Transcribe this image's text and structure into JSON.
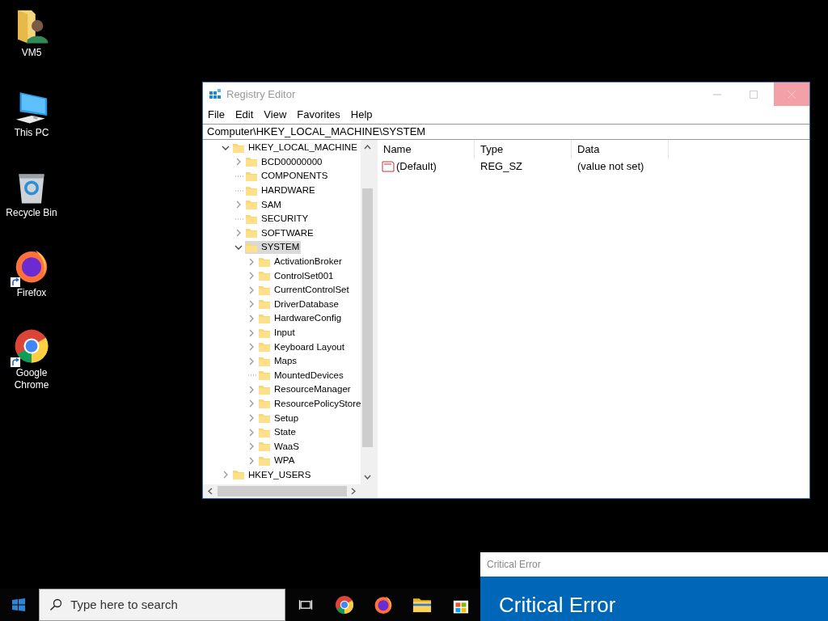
{
  "desktop_icons": [
    {
      "label": "VM5",
      "kind": "user-folder",
      "shortcut": false
    },
    {
      "label": "This PC",
      "kind": "computer",
      "shortcut": false
    },
    {
      "label": "Recycle Bin",
      "kind": "recycle-bin",
      "shortcut": false
    },
    {
      "label": "Firefox",
      "kind": "firefox",
      "shortcut": true
    },
    {
      "label": "Google Chrome",
      "kind": "chrome",
      "shortcut": true
    }
  ],
  "registry_editor": {
    "title": "Registry Editor",
    "menu": [
      "File",
      "Edit",
      "View",
      "Favorites",
      "Help"
    ],
    "address": "Computer\\HKEY_LOCAL_MACHINE\\SYSTEM",
    "tree": [
      {
        "label": "HKEY_LOCAL_MACHINE",
        "kind": "branch",
        "expanded": true,
        "selected": false,
        "children": [
          {
            "label": "BCD00000000",
            "kind": "branch",
            "expanded": false,
            "selected": false
          },
          {
            "label": "COMPONENTS",
            "kind": "leaf",
            "selected": false
          },
          {
            "label": "HARDWARE",
            "kind": "leaf",
            "selected": false
          },
          {
            "label": "SAM",
            "kind": "branch",
            "expanded": false,
            "selected": false
          },
          {
            "label": "SECURITY",
            "kind": "leaf",
            "selected": false
          },
          {
            "label": "SOFTWARE",
            "kind": "branch",
            "expanded": false,
            "selected": false
          },
          {
            "label": "SYSTEM",
            "kind": "branch",
            "expanded": true,
            "selected": true,
            "children": [
              {
                "label": "ActivationBroker",
                "kind": "branch",
                "expanded": false,
                "selected": false
              },
              {
                "label": "ControlSet001",
                "kind": "branch",
                "expanded": false,
                "selected": false
              },
              {
                "label": "CurrentControlSet",
                "kind": "branch",
                "expanded": false,
                "selected": false
              },
              {
                "label": "DriverDatabase",
                "kind": "branch",
                "expanded": false,
                "selected": false
              },
              {
                "label": "HardwareConfig",
                "kind": "branch",
                "expanded": false,
                "selected": false
              },
              {
                "label": "Input",
                "kind": "branch",
                "expanded": false,
                "selected": false
              },
              {
                "label": "Keyboard Layout",
                "kind": "branch",
                "expanded": false,
                "selected": false
              },
              {
                "label": "Maps",
                "kind": "branch",
                "expanded": false,
                "selected": false
              },
              {
                "label": "MountedDevices",
                "kind": "leaf",
                "selected": false
              },
              {
                "label": "ResourceManager",
                "kind": "branch",
                "expanded": false,
                "selected": false
              },
              {
                "label": "ResourcePolicyStore",
                "kind": "branch",
                "expanded": false,
                "selected": false
              },
              {
                "label": "Setup",
                "kind": "branch",
                "expanded": false,
                "selected": false
              },
              {
                "label": "State",
                "kind": "branch",
                "expanded": false,
                "selected": false
              },
              {
                "label": "WaaS",
                "kind": "branch",
                "expanded": false,
                "selected": false
              },
              {
                "label": "WPA",
                "kind": "branch",
                "expanded": false,
                "selected": false
              }
            ]
          }
        ]
      },
      {
        "label": "HKEY_USERS",
        "kind": "branch",
        "expanded": false,
        "selected": false
      }
    ],
    "columns": [
      "Name",
      "Type",
      "Data"
    ],
    "values": [
      {
        "name": "(Default)",
        "type": "REG_SZ",
        "data": "(value not set)"
      }
    ]
  },
  "taskbar": {
    "search_placeholder": "Type here to search",
    "apps": [
      {
        "kind": "task-view"
      },
      {
        "kind": "chrome"
      },
      {
        "kind": "firefox"
      },
      {
        "kind": "file-explorer"
      },
      {
        "kind": "store"
      }
    ]
  },
  "error_dialog": {
    "title": "Critical Error",
    "heading": "Critical Error"
  }
}
